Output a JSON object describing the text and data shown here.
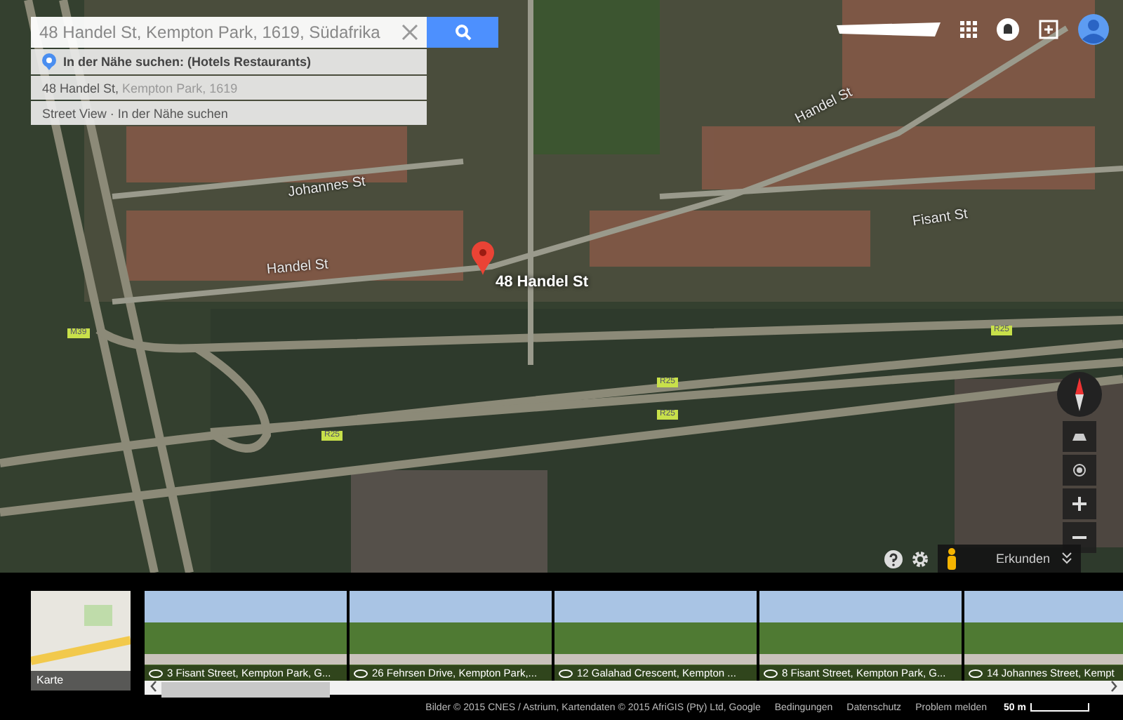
{
  "search": {
    "value": "48 Handel St, Kempton Park, 1619, Südafrika"
  },
  "suggestions": [
    {
      "kind": "nearby",
      "text": "In der Nähe suchen: (Hotels Restaurants)"
    },
    {
      "kind": "address",
      "main": "48 Handel St,",
      "secondary": "Kempton Park, 1619"
    },
    {
      "kind": "plain",
      "text": "Street View · In der Nähe suchen"
    }
  ],
  "map": {
    "pin_label": "48 Handel St",
    "labels": [
      {
        "kind": "street",
        "text": "Handel St"
      },
      {
        "kind": "street",
        "text": "Handel St"
      },
      {
        "kind": "street",
        "text": "Johannes St"
      },
      {
        "kind": "street",
        "text": "Fisant St"
      },
      {
        "kind": "shield",
        "text": "M39"
      },
      {
        "kind": "shield",
        "text": "R25"
      },
      {
        "kind": "shield",
        "text": "R25"
      },
      {
        "kind": "shield",
        "text": "R25"
      },
      {
        "kind": "shield",
        "text": "R25"
      }
    ]
  },
  "explore": {
    "label": "Erkunden"
  },
  "strip": {
    "map_label": "Karte",
    "photos": [
      {
        "caption": "3 Fisant Street, Kempton Park, G..."
      },
      {
        "caption": "26 Fehrsen Drive, Kempton Park,..."
      },
      {
        "caption": "12 Galahad Crescent, Kempton ..."
      },
      {
        "caption": "8 Fisant Street, Kempton Park, G..."
      },
      {
        "caption": "14 Johannes Street, Kempt"
      }
    ]
  },
  "footer": {
    "items": [
      "Bilder © 2015 CNES / Astrium, Kartendaten © 2015 AfriGIS (Pty) Ltd, Google",
      "Bedingungen",
      "Datenschutz",
      "Problem melden"
    ],
    "scale": "50 m"
  }
}
